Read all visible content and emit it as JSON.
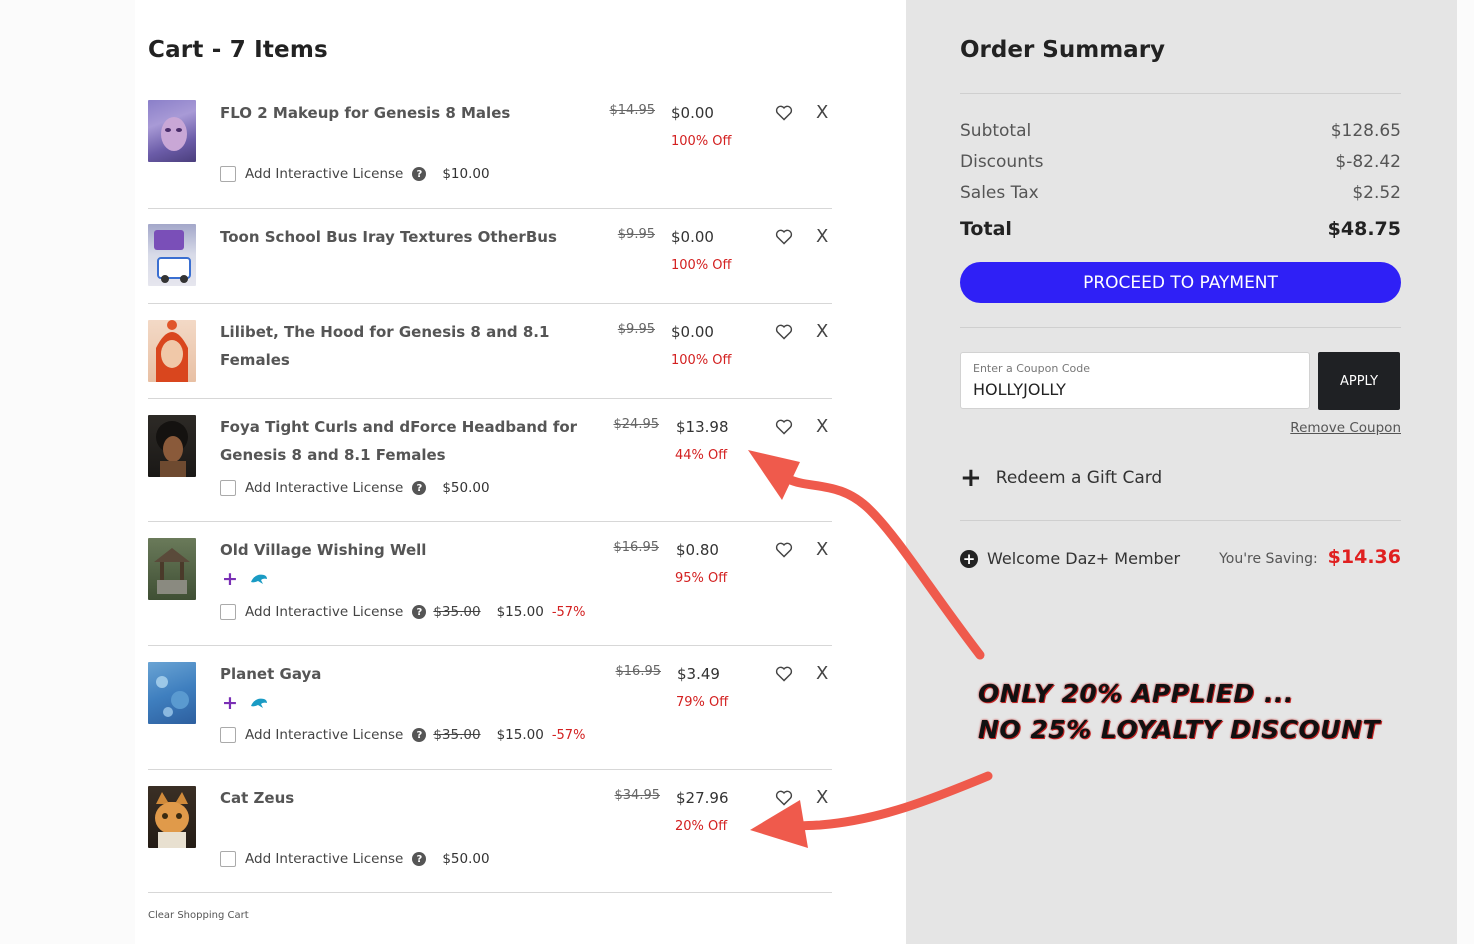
{
  "cart": {
    "title": "Cart - 7 Items",
    "clear_label": "Clear Shopping Cart",
    "remove_glyph": "X",
    "license_label": "Add Interactive License",
    "items": [
      {
        "title": "FLO 2 Makeup for Genesis 8 Males",
        "original": "$14.95",
        "price": "$0.00",
        "off": "100% Off",
        "license_price": "$10.00"
      },
      {
        "title": "Toon School Bus Iray Textures OtherBus",
        "original": "$9.95",
        "price": "$0.00",
        "off": "100% Off"
      },
      {
        "title": "Lilibet, The Hood for Genesis 8 and 8.1 Females",
        "original": "$9.95",
        "price": "$0.00",
        "off": "100% Off"
      },
      {
        "title_line1": "Foya Tight Curls and dForce Headband for",
        "title_line2": "Genesis 8 and 8.1 Females",
        "original": "$24.95",
        "price": "$13.98",
        "off": "44% Off",
        "license_price": "$50.00"
      },
      {
        "title": "Old Village Wishing Well",
        "original": "$16.95",
        "price": "$0.80",
        "off": "95% Off",
        "license_strike": "$35.00",
        "license_sale": "$15.00",
        "license_pct": "-57%"
      },
      {
        "title": "Planet Gaya",
        "original": "$16.95",
        "price": "$3.49",
        "off": "79% Off",
        "license_strike": "$35.00",
        "license_sale": "$15.00",
        "license_pct": "-57%"
      },
      {
        "title": "Cat Zeus",
        "original": "$34.95",
        "price": "$27.96",
        "off": "20% Off",
        "license_price": "$50.00"
      }
    ]
  },
  "summary": {
    "title": "Order Summary",
    "subtotal_label": "Subtotal",
    "subtotal": "$128.65",
    "discounts_label": "Discounts",
    "discounts": "$-82.42",
    "tax_label": "Sales Tax",
    "tax": "$2.52",
    "total_label": "Total",
    "total": "$48.75",
    "proceed_label": "PROCEED TO PAYMENT",
    "coupon_placeholder": "Enter a Coupon Code",
    "coupon_value": "HOLLYJOLLY",
    "apply_label": "APPLY",
    "remove_coupon_label": "Remove Coupon",
    "gift_label": "Redeem a Gift Card",
    "member_label": "Welcome Daz+ Member",
    "saving_label": "You're Saving:",
    "saving_value": "$14.36"
  },
  "annotation": {
    "line1": "ONLY 20% APPLIED ...",
    "line2": "NO 25% LOYALTY DISCOUNT"
  },
  "colors": {
    "accent_button": "#2f20f6",
    "discount_red": "#d32020",
    "panel_gray": "#e5e5e5",
    "arrow_red": "#ef5a4c"
  },
  "icons": [
    "heart-icon",
    "help-icon",
    "plus-badge-icon",
    "dolphin-icon",
    "plus-icon",
    "plus-circle-icon"
  ]
}
